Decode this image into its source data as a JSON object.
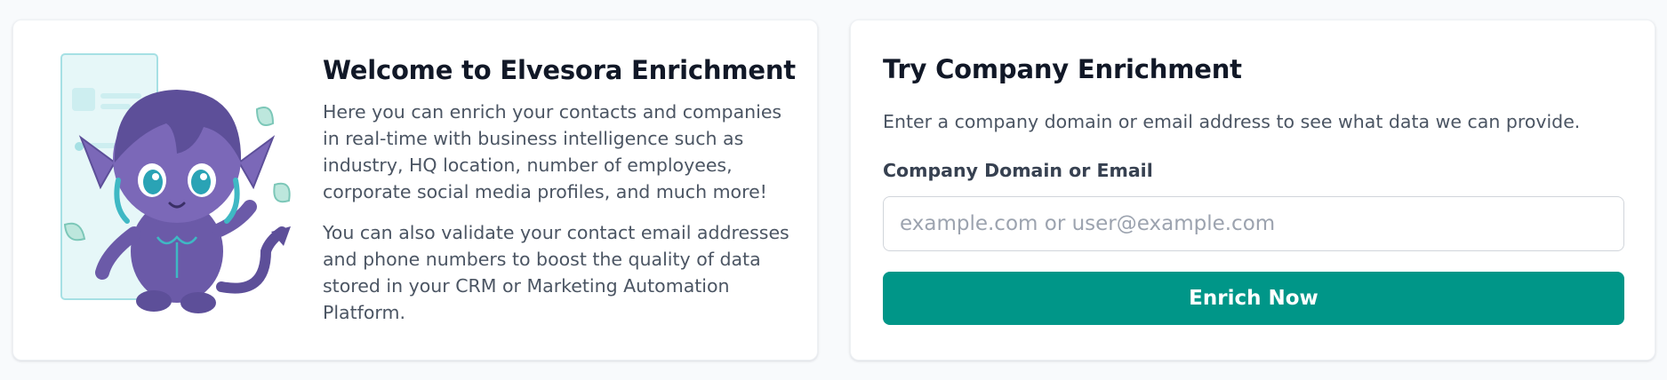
{
  "welcome": {
    "title": "Welcome to Elvesora Enrichment",
    "paragraph_1": "Here you can enrich your contacts and companies in real-time with business intelligence such as industry, HQ location, number of employees, corporate social media profiles, and much more!",
    "paragraph_2": "You can also validate your contact email addresses and phone numbers to boost the quality of data stored in your CRM or Marketing Automation Platform."
  },
  "mascot": {
    "icon": "elf-mascot-illustration"
  },
  "enrichment": {
    "title": "Try Company Enrichment",
    "description": "Enter a company domain or email address to see what data we can provide.",
    "input_label": "Company Domain or Email",
    "input_placeholder": "example.com or user@example.com",
    "input_value": "",
    "button_label": "Enrich Now"
  },
  "colors": {
    "accent": "#009688",
    "mascot_purple": "#6b5aa8",
    "mascot_teal": "#3fb8c4",
    "page_background": "#f8fafc"
  }
}
